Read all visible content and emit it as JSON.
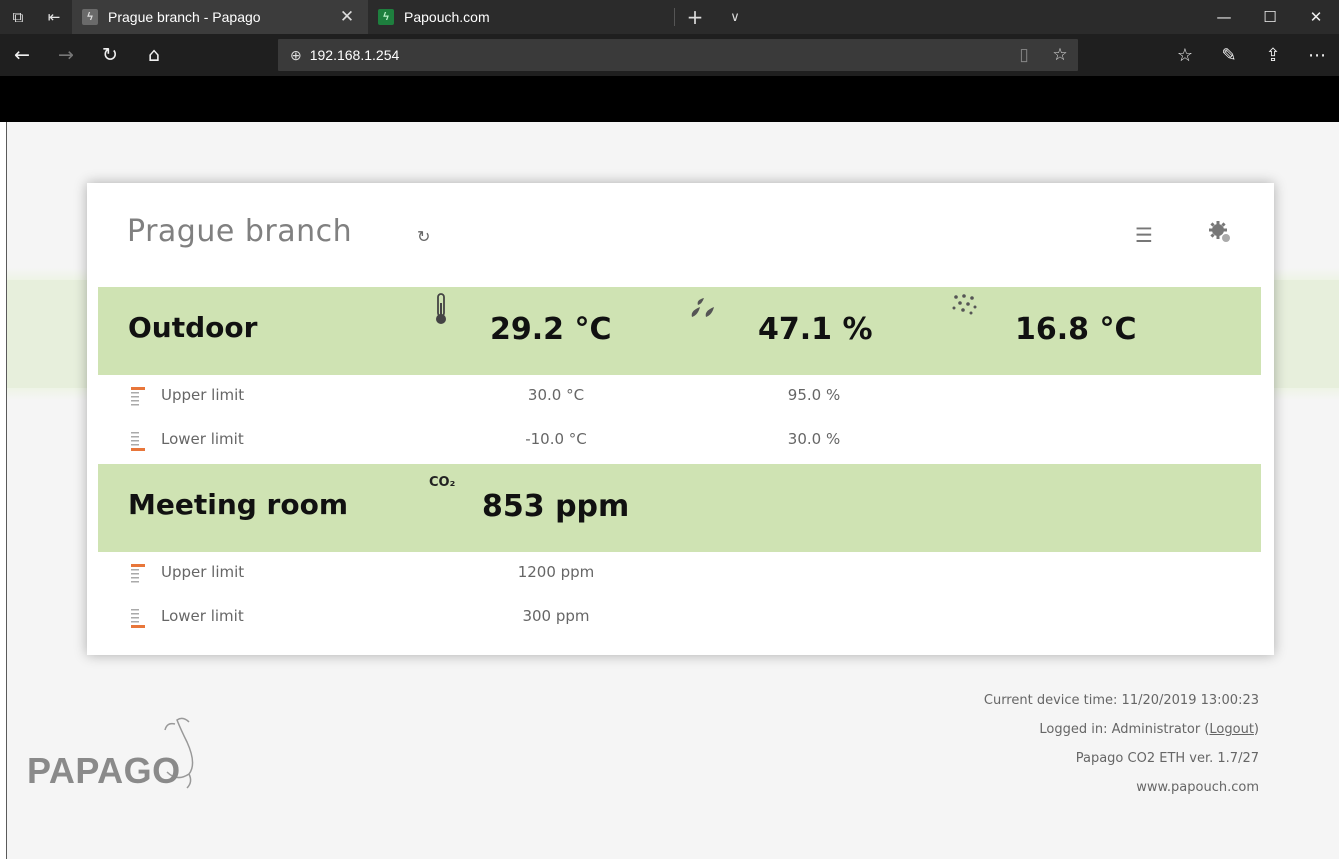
{
  "browser": {
    "tabs": [
      {
        "title": "Prague branch - Papago",
        "favicon": "papago-favicon",
        "active": true
      },
      {
        "title": "Papouch.com",
        "favicon": "papouch-favicon",
        "active": false
      }
    ],
    "url": "192.168.1.254"
  },
  "card": {
    "title": "Prague branch"
  },
  "sensors": [
    {
      "name": "Outdoor",
      "values": [
        {
          "icon": "thermometer-icon",
          "value": "29.2 °C"
        },
        {
          "icon": "humidity-drops-icon",
          "value": "47.1 %"
        },
        {
          "icon": "dew-point-icon",
          "value": "16.8 °C"
        }
      ],
      "limits": {
        "upper_label": "Upper limit",
        "upper_values": [
          "30.0 °C",
          "95.0 %"
        ],
        "lower_label": "Lower limit",
        "lower_values": [
          "-10.0 °C",
          "30.0 %"
        ]
      }
    },
    {
      "name": "Meeting room",
      "values": [
        {
          "icon": "co2-icon",
          "icon_text": "CO₂",
          "value": "853 ppm"
        }
      ],
      "limits": {
        "upper_label": "Upper limit",
        "upper_values": [
          "1200 ppm"
        ],
        "lower_label": "Lower limit",
        "lower_values": [
          "300 ppm"
        ]
      }
    }
  ],
  "footer": {
    "device_time": "Current device time: 11/20/2019 13:00:23",
    "logged_in_prefix": "Logged in: Administrator (",
    "logout": "Logout",
    "logged_in_suffix": ")",
    "version": "Papago CO2 ETH ver. 1.7/27",
    "website": "www.papouch.com"
  },
  "logo": {
    "text": "PAPAGO"
  },
  "colors": {
    "sensor_row_bg": "#cfe3b3",
    "accent_orange": "#e8763a",
    "chrome_dark": "#1f1f1f"
  }
}
